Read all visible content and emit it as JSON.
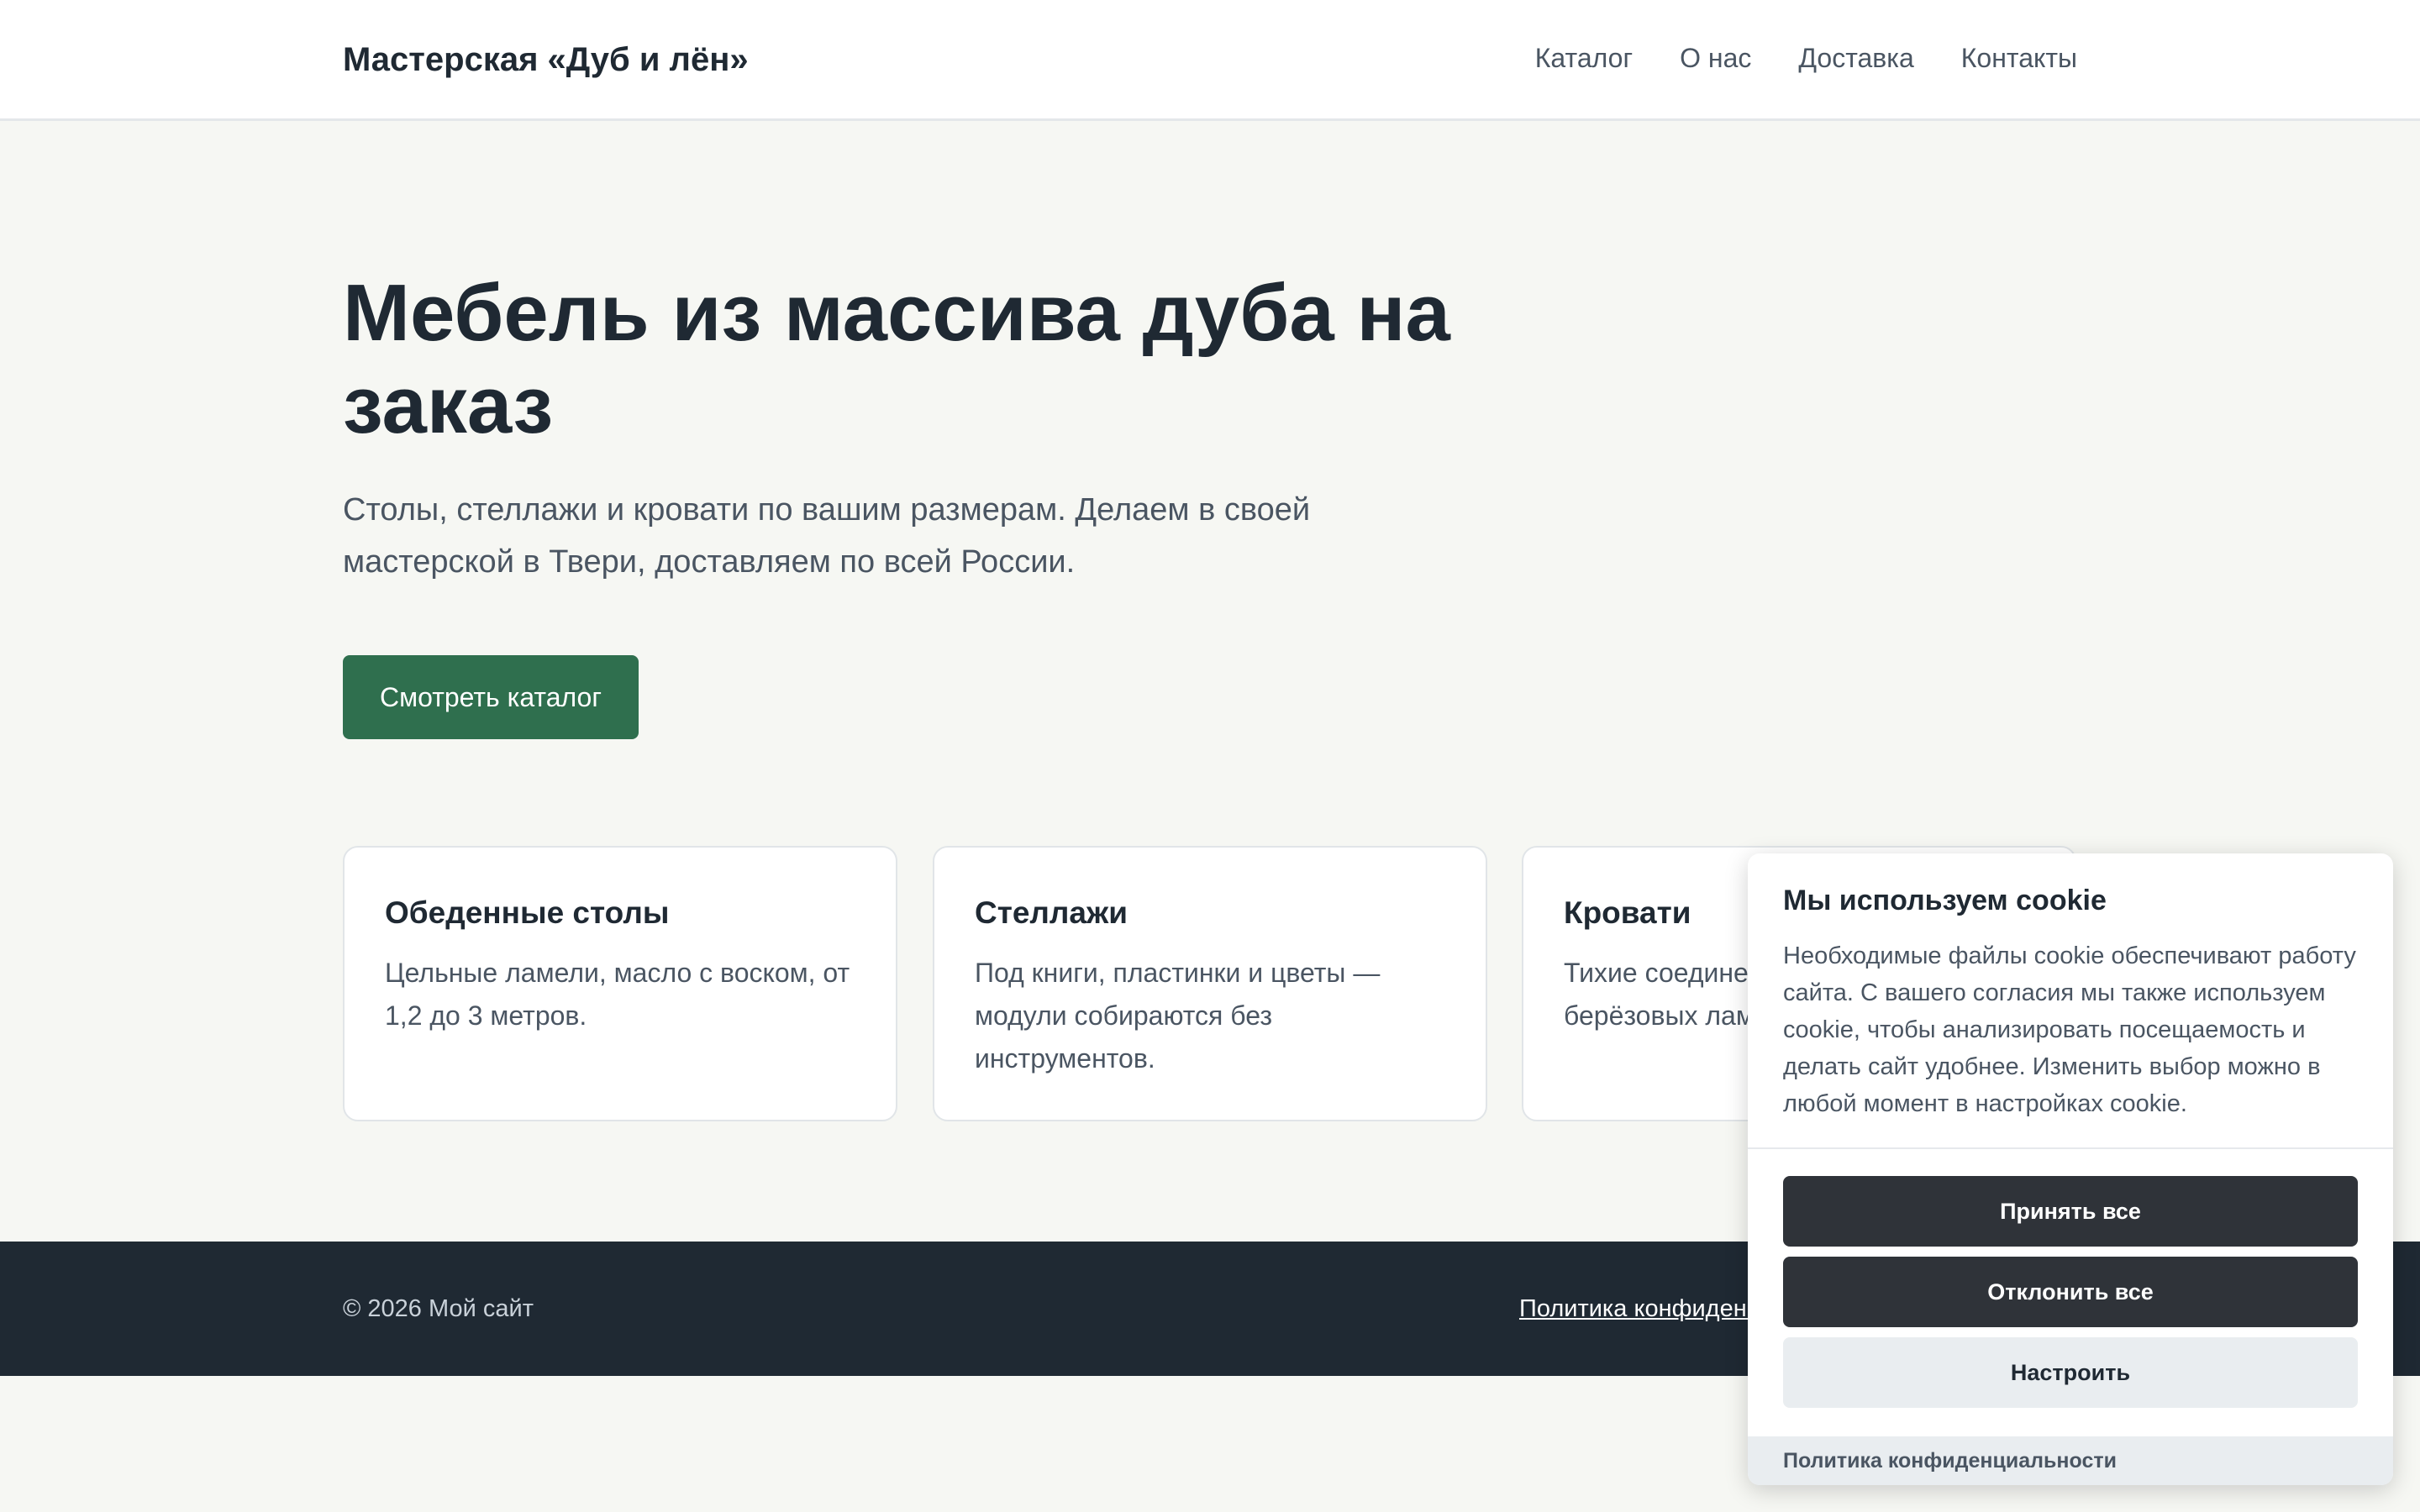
{
  "header": {
    "brand": "Мастерская «Дуб и лён»",
    "nav": [
      "Каталог",
      "О нас",
      "Доставка",
      "Контакты"
    ]
  },
  "hero": {
    "title": "Мебель из массива дуба на заказ",
    "subtitle": "Столы, стеллажи и кровати по вашим размерам. Делаем в своей мастерской в Твери, доставляем по всей России.",
    "cta_label": "Смотреть каталог"
  },
  "cards": [
    {
      "title": "Обеденные столы",
      "text": "Цельные ламели, масло с воском, от 1,2 до 3 метров."
    },
    {
      "title": "Стеллажи",
      "text": "Под книги, пластинки и цветы — модули собираются без инструментов."
    },
    {
      "title": "Кровати",
      "text": "Тихие соединения и основание из берёзовых ламелей."
    }
  ],
  "footer": {
    "copyright": "© 2026 Мой сайт",
    "privacy_link": "Политика конфиденциальности"
  },
  "cookie_banner": {
    "title": "Мы используем cookie",
    "text": "Необходимые файлы cookie обеспечивают работу сайта. С вашего согласия мы также используем cookie, чтобы анализировать посещаемость и делать сайт удобнее. Изменить выбор можно в любой момент в настройках cookie.",
    "accept_label": "Принять все",
    "reject_label": "Отклонить все",
    "customize_label": "Настроить",
    "privacy_link": "Политика конфиденциальности"
  },
  "colors": {
    "accent": "#2f6f4e",
    "footer_bg": "#1f2933",
    "page_bg": "#f6f7f3",
    "cookie_button_dark": "#2f3339"
  }
}
